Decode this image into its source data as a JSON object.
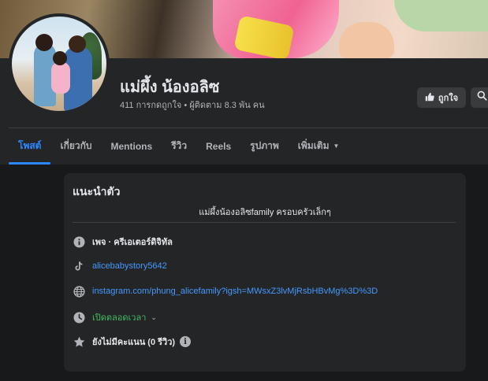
{
  "page": {
    "name": "แม่ผึ้ง น้องอลิซ",
    "stats": "411 การกดถูกใจ • ผู้ติดตาม 8.3 พัน คน"
  },
  "actions": {
    "like_label": "ถูกใจ",
    "like_icon": "thumbs-up-icon",
    "search_icon": "search-icon"
  },
  "tabs": [
    {
      "label": "โพสต์",
      "active": true
    },
    {
      "label": "เกี่ยวกับ",
      "active": false
    },
    {
      "label": "Mentions",
      "active": false
    },
    {
      "label": "รีวิว",
      "active": false
    },
    {
      "label": "Reels",
      "active": false
    },
    {
      "label": "รูปภาพ",
      "active": false
    },
    {
      "label": "เพิ่มเติม",
      "active": false,
      "dropdown": true
    }
  ],
  "intro": {
    "title": "แนะนำตัว",
    "bio": "แม่ผึ้งน้องอลิซfamily ครอบครัวเล็กๆ",
    "category": "เพจ · ครีเอเตอร์ดิจิทัล",
    "tiktok": "alicebabystory5642",
    "website": "instagram.com/phung_alicefamily?igsh=MWsxZ3lvMjRsbHBvMg%3D%3D",
    "hours": "เปิดตลอดเวลา",
    "rating": "ยังไม่มีคะแนน (0 รีวิว)"
  },
  "colors": {
    "accent": "#2d88ff",
    "link": "#4599ff",
    "open": "#45bd62",
    "background": "#18191a",
    "surface": "#242526"
  }
}
